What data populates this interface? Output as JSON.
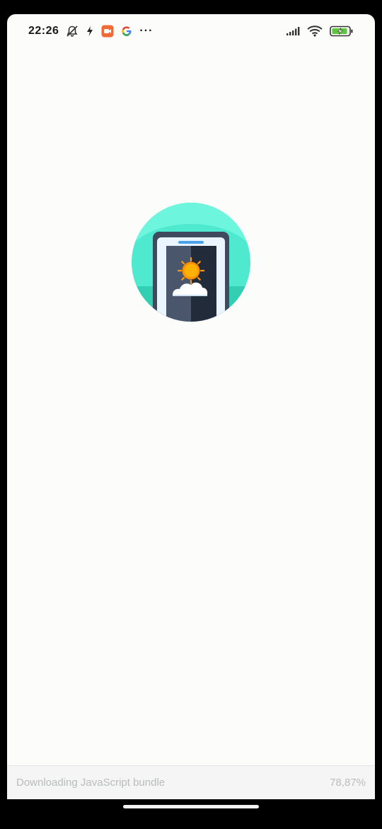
{
  "status_bar": {
    "time": "22:26",
    "more": "···",
    "icons": [
      "bell-off-icon",
      "lightning-icon",
      "camera-app-icon",
      "google-g-icon",
      "signal-icon",
      "wifi-icon",
      "battery-charging-icon"
    ],
    "colors": {
      "camera_app": "#f06a36"
    }
  },
  "splash": {
    "logo": "weather-phone-logo",
    "colors": {
      "circle": "#4ee9cf",
      "phone_frame": "#3f4a5f",
      "screen_left": "#4a566c",
      "screen_right": "#222b3a",
      "sun": "#ffb300",
      "cloud": "#ffffff"
    }
  },
  "loading": {
    "message": "Downloading JavaScript bundle",
    "progress_text": "78,87%",
    "progress": 0.7887
  }
}
